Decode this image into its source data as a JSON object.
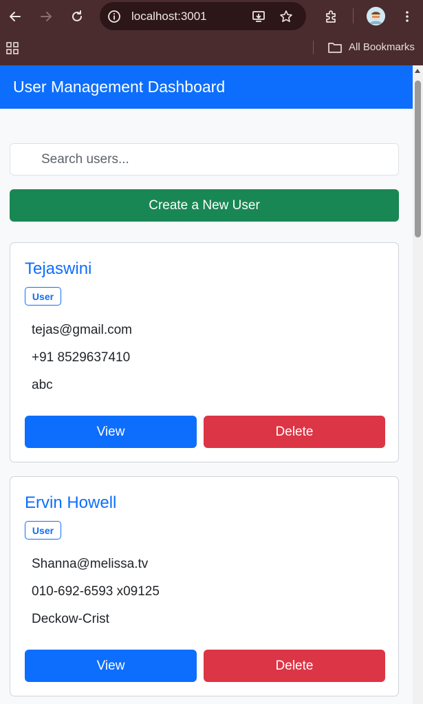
{
  "browser": {
    "url": "localhost:3001",
    "bookmarks_label": "All Bookmarks"
  },
  "colors": {
    "chrome": "#4a2c2e",
    "primary": "#0d6efd",
    "success": "#198754",
    "danger": "#dc3545"
  },
  "app": {
    "title": "User Management Dashboard"
  },
  "search": {
    "placeholder": "Search users..."
  },
  "create_button": "Create a New User",
  "users": [
    {
      "name": "Tejaswini",
      "role": "User",
      "email": "tejas@gmail.com",
      "phone": "+91 8529637410",
      "company": "abc",
      "view_label": "View",
      "delete_label": "Delete"
    },
    {
      "name": "Ervin Howell",
      "role": "User",
      "email": "Shanna@melissa.tv",
      "phone": "010-692-6593 x09125",
      "company": "Deckow-Crist",
      "view_label": "View",
      "delete_label": "Delete"
    }
  ]
}
